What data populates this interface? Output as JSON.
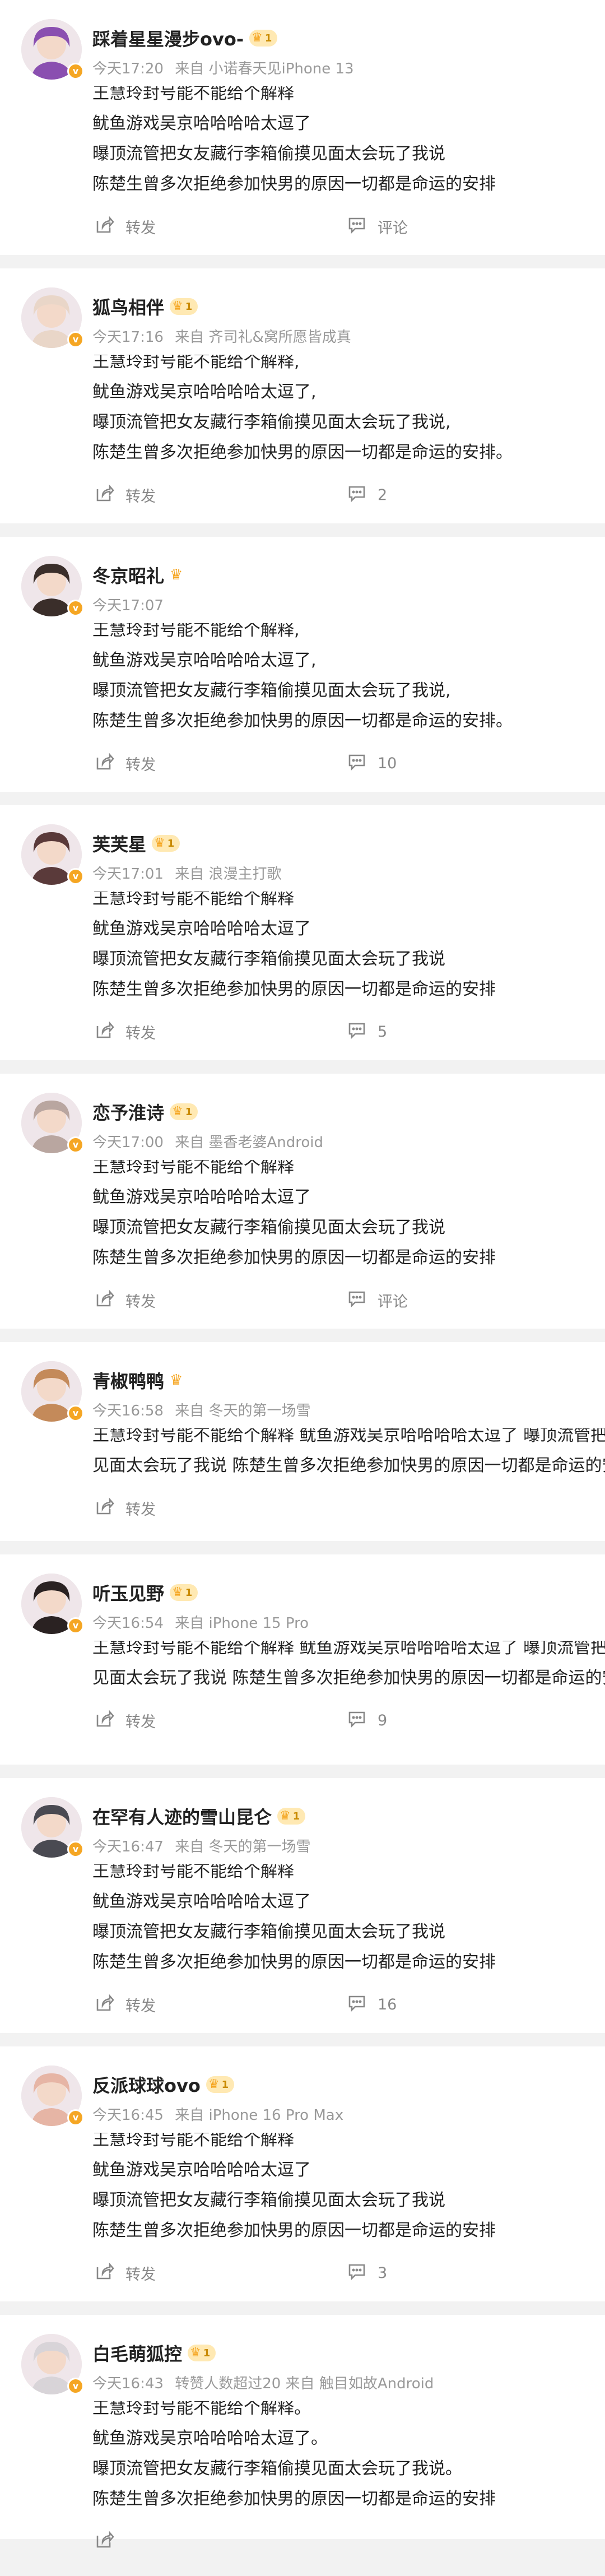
{
  "posts": [
    {
      "username": "踩着星星漫步ovo-",
      "badge": "crown-level",
      "level": "1",
      "time": "今天17:20",
      "source": "来自 小诺春天见iPhone 13",
      "lines": [
        "王慧玲封号能不能给个解释",
        "鱿鱼游戏吴京哈哈哈哈太逗了",
        "曝顶流管把女友藏行李箱偷摸见面太会玩了我说",
        "陈楚生曾多次拒绝参加快男的原因一切都是命运的安排"
      ],
      "forward": "转发",
      "comment": "评论",
      "avatar_color": "#8a4fb0"
    },
    {
      "username": "狐鸟相伴",
      "badge": "crown-level",
      "level": "1",
      "time": "今天17:16",
      "source": "来自 齐司礼&窝所愿皆成真",
      "lines": [
        "王慧玲封号能不能给个解释,",
        "鱿鱼游戏吴京哈哈哈哈太逗了,",
        "曝顶流管把女友藏行李箱偷摸见面太会玩了我说,",
        "陈楚生曾多次拒绝参加快男的原因一切都是命运的安排。"
      ],
      "forward": "转发",
      "comment": "2",
      "avatar_color": "#e9d6c8"
    },
    {
      "username": "冬京昭礼",
      "badge": "crown",
      "level": "",
      "time": "今天17:07",
      "source": "",
      "lines": [
        "王慧玲封号能不能给个解释,",
        "鱿鱼游戏吴京哈哈哈哈太逗了,",
        "曝顶流管把女友藏行李箱偷摸见面太会玩了我说,",
        "陈楚生曾多次拒绝参加快男的原因一切都是命运的安排。"
      ],
      "forward": "转发",
      "comment": "10",
      "avatar_color": "#3a2e2a"
    },
    {
      "username": "芙芙星",
      "badge": "crown-level",
      "level": "1",
      "time": "今天17:01",
      "source": "来自 浪漫主打歌",
      "lines": [
        "王慧玲封号能不能给个解释",
        "鱿鱼游戏吴京哈哈哈哈太逗了",
        "曝顶流管把女友藏行李箱偷摸见面太会玩了我说",
        "陈楚生曾多次拒绝参加快男的原因一切都是命运的安排"
      ],
      "forward": "转发",
      "comment": "5",
      "avatar_color": "#5a3a3a"
    },
    {
      "username": "恋予淮诗",
      "badge": "crown-level",
      "level": "1",
      "time": "今天17:00",
      "source": "来自 墨香老婆Android",
      "lines": [
        "王慧玲封号能不能给个解释",
        "鱿鱼游戏吴京哈哈哈哈太逗了",
        "曝顶流管把女友藏行李箱偷摸见面太会玩了我说",
        "陈楚生曾多次拒绝参加快男的原因一切都是命运的安排"
      ],
      "forward": "转发",
      "comment": "评论",
      "avatar_color": "#b9a6a0"
    },
    {
      "username": "青椒鸭鸭",
      "badge": "crown",
      "level": "",
      "time": "今天16:58",
      "source": "来自 冬天的第一场雪",
      "lines": [
        "王慧玲封号能不能给个解释 鱿鱼游戏吴京哈哈哈哈太逗了 曝顶流管把女友藏行李箱偷摸",
        "见面太会玩了我说 陈楚生曾多次拒绝参加快男的原因一切都是命运的安排"
      ],
      "forward": "转发",
      "comment": "",
      "avatar_color": "#c48a5a"
    },
    {
      "username": "听玉见野",
      "badge": "crown-level",
      "level": "1",
      "time": "今天16:54",
      "source": "来自 iPhone 15 Pro",
      "lines": [
        "王慧玲封号能不能给个解释 鱿鱼游戏吴京哈哈哈哈太逗了 曝顶流管把女友藏行李箱偷摸",
        "见面太会玩了我说 陈楚生曾多次拒绝参加快男的原因一切都是命运的安排"
      ],
      "forward": "转发",
      "comment": "9",
      "avatar_color": "#2a2222"
    },
    {
      "username": "在罕有人迹的雪山昆仑",
      "badge": "crown-level",
      "level": "1",
      "time": "今天16:47",
      "source": "来自 冬天的第一场雪",
      "lines": [
        "王慧玲封号能不能给个解释",
        "鱿鱼游戏吴京哈哈哈哈太逗了",
        "曝顶流管把女友藏行李箱偷摸见面太会玩了我说",
        "陈楚生曾多次拒绝参加快男的原因一切都是命运的安排"
      ],
      "forward": "转发",
      "comment": "16",
      "avatar_color": "#4a4a52"
    },
    {
      "username": "反派球球ovo",
      "badge": "crown-level",
      "level": "1",
      "time": "今天16:45",
      "source": "来自 iPhone 16 Pro Max",
      "lines": [
        "王慧玲封号能不能给个解释",
        "鱿鱼游戏吴京哈哈哈哈太逗了",
        "曝顶流管把女友藏行李箱偷摸见面太会玩了我说",
        "陈楚生曾多次拒绝参加快男的原因一切都是命运的安排"
      ],
      "forward": "转发",
      "comment": "3",
      "avatar_color": "#e6b5a5"
    },
    {
      "username": "白毛萌狐控",
      "badge": "crown-level",
      "level": "1",
      "time": "今天16:43",
      "source": "转赞人数超过20  来自 触目如故Android",
      "lines": [
        "王慧玲封号能不能给个解释。",
        "鱿鱼游戏吴京哈哈哈哈太逗了。",
        "曝顶流管把女友藏行李箱偷摸见面太会玩了我说。",
        "陈楚生曾多次拒绝参加快男的原因一切都是命运的安排"
      ],
      "forward": "",
      "comment": "",
      "avatar_color": "#d8d4d8"
    }
  ]
}
